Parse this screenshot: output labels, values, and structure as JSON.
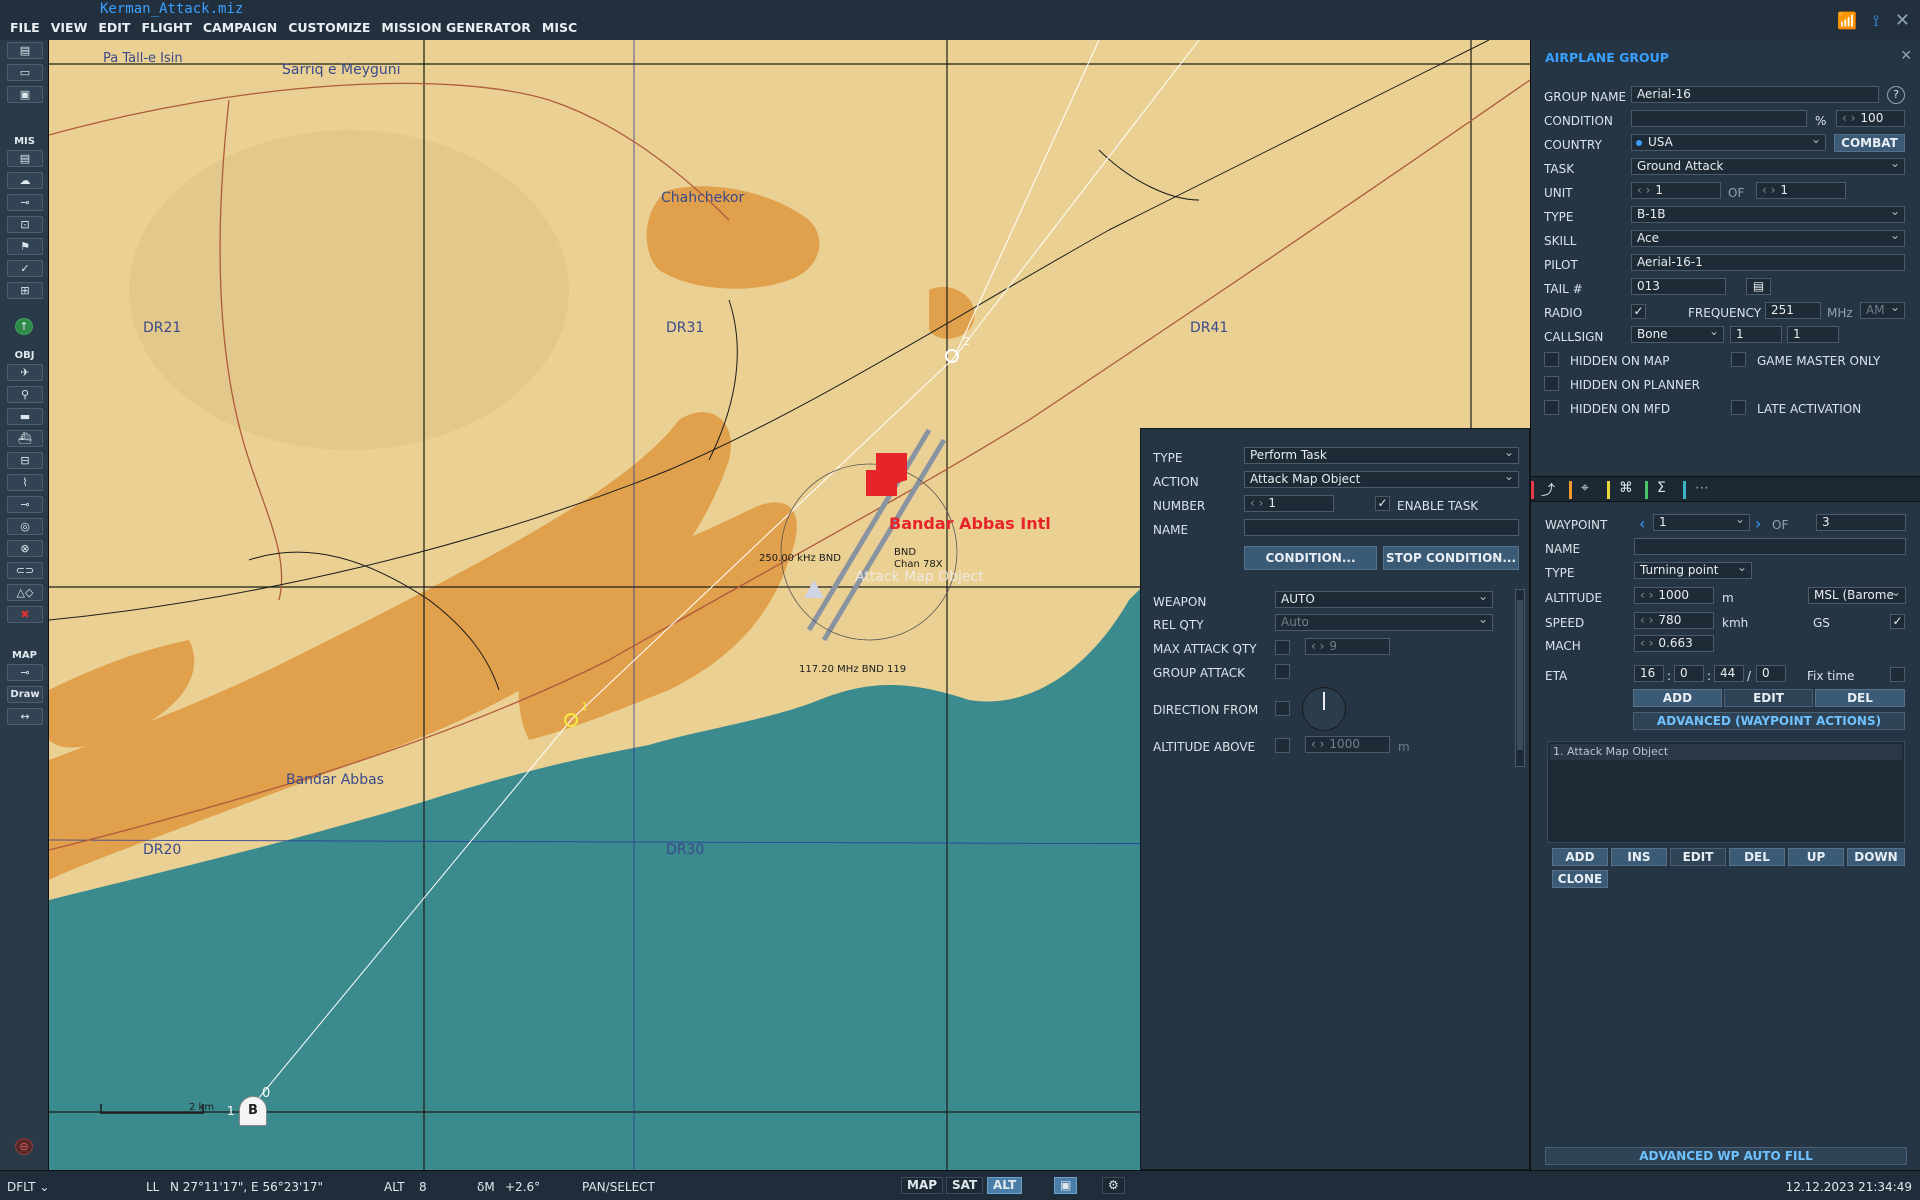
{
  "title": {
    "filename": "Kerman_Attack.miz"
  },
  "menu": [
    "FILE",
    "VIEW",
    "EDIT",
    "FLIGHT",
    "CAMPAIGN",
    "CUSTOMIZE",
    "MISSION GENERATOR",
    "MISC"
  ],
  "toolbar": {
    "mis_label": "MIS",
    "obj_label": "OBJ",
    "map_label": "MAP",
    "draw_label": "Draw"
  },
  "map": {
    "places": [
      "Pa Tall-e Isin",
      "Sarriq e Meyguni",
      "Chahchekor",
      "Bandar Abbas"
    ],
    "grid": [
      "DR21",
      "DR31",
      "DR41",
      "DR20",
      "DR30"
    ],
    "airbase": "Bandar Abbas Intl",
    "ndb_label": "250.00 kHz BND",
    "tacan_label": "BND",
    "tacan_chan": "Chan 78X",
    "vor_label": "117.20 MHz BND 119",
    "target_label": "Attack Map Object",
    "wp_labels": [
      "0",
      "1",
      "2"
    ],
    "group_marker": "B",
    "group_number": "1",
    "scale_label": "2 km"
  },
  "group": {
    "title": "AIRPLANE GROUP",
    "group_name_label": "GROUP NAME",
    "group_name": "Aerial-16",
    "condition_label": "CONDITION",
    "condition_value": "",
    "pct": "%",
    "condition_pct": "100",
    "country_label": "COUNTRY",
    "country": "USA",
    "combat": "COMBAT",
    "task_label": "TASK",
    "task": "Ground Attack",
    "unit_label": "UNIT",
    "unit": "1",
    "of": "OF",
    "unit_total": "1",
    "type_label": "TYPE",
    "type": "B-1B",
    "skill_label": "SKILL",
    "skill": "Ace",
    "pilot_label": "PILOT",
    "pilot": "Aerial-16-1",
    "tail_label": "TAIL #",
    "tail": "013",
    "radio_label": "RADIO",
    "freq_label": "FREQUENCY",
    "freq": "251",
    "mhz": "MHz",
    "mod": "AM",
    "callsign_label": "CALLSIGN",
    "callsign": "Bone",
    "cs1": "1",
    "cs2": "1",
    "hidden_map": "HIDDEN ON MAP",
    "gm_only": "GAME MASTER ONLY",
    "hidden_planner": "HIDDEN ON PLANNER",
    "hidden_mfd": "HIDDEN ON MFD",
    "late": "LATE ACTIVATION"
  },
  "waypoint": {
    "wp_label": "WAYPOINT",
    "wp": "1",
    "of": "OF",
    "wp_total": "3",
    "name_label": "NAME",
    "name": "",
    "type_label": "TYPE",
    "type": "Turning point",
    "alt_label": "ALTITUDE",
    "alt": "1000",
    "alt_unit": "m",
    "alt_type": "MSL (Barome",
    "speed_label": "SPEED",
    "speed": "780",
    "speed_unit": "kmh",
    "gs": "GS",
    "mach_label": "MACH",
    "mach": "0.663",
    "eta_label": "ETA",
    "eta_h": "16",
    "eta_m": "0",
    "eta_s": "44",
    "eta_d": "0",
    "fixtime": "Fix time",
    "add": "ADD",
    "edit": "EDIT",
    "del": "DEL",
    "advanced": "ADVANCED (WAYPOINT ACTIONS)",
    "actions": [
      "1. Attack Map Object"
    ],
    "btns": [
      "ADD",
      "INS",
      "EDIT",
      "DEL",
      "UP",
      "DOWN",
      "CLONE"
    ],
    "autofill": "ADVANCED WP AUTO FILL"
  },
  "task": {
    "type_label": "TYPE",
    "type": "Perform Task",
    "action_label": "ACTION",
    "action": "Attack Map Object",
    "number_label": "NUMBER",
    "number": "1",
    "enable": "ENABLE TASK",
    "name_label": "NAME",
    "name": "",
    "condition": "CONDITION...",
    "stop": "STOP CONDITION...",
    "weapon_label": "WEAPON",
    "weapon": "AUTO",
    "relqty_label": "REL QTY",
    "relqty": "Auto",
    "maxqty_label": "MAX ATTACK QTY",
    "maxqty": "9",
    "group_label": "GROUP ATTACK",
    "dir_label": "DIRECTION FROM",
    "altabove_label": "ALTITUDE ABOVE",
    "altabove": "1000",
    "altabove_unit": "m"
  },
  "status": {
    "dflt": "DFLT",
    "ll": "LL",
    "coords": "N 27°11'17\", E 56°23'17\"",
    "alt_label": "ALT",
    "alt": "8",
    "dm": "δM",
    "dm_val": "+2.6°",
    "mode": "PAN/SELECT",
    "map": "MAP",
    "sat": "SAT",
    "altb": "ALT",
    "datetime": "12.12.2023 21:34:49"
  },
  "colors": {
    "accent": "#3aa0ff",
    "land": "#ead193",
    "urban": "#e0a04c",
    "sea": "#3a8a8e",
    "airbase": "#e8242b"
  }
}
